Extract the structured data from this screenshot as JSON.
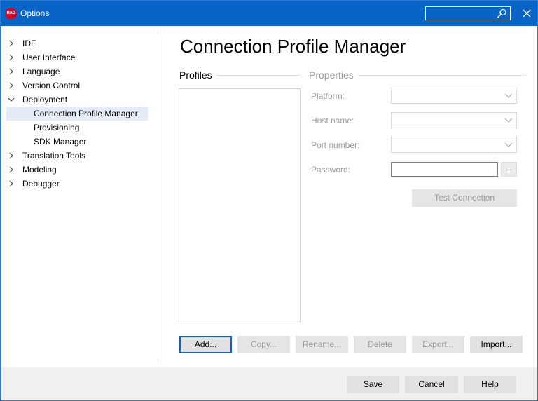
{
  "window": {
    "title": "Options",
    "app_icon_text": "RAD",
    "search_value": ""
  },
  "tree": {
    "items": [
      {
        "label": "IDE",
        "expanded": false
      },
      {
        "label": "User Interface",
        "expanded": false
      },
      {
        "label": "Language",
        "expanded": false
      },
      {
        "label": "Version Control",
        "expanded": false
      },
      {
        "label": "Deployment",
        "expanded": true
      },
      {
        "label": "Connection Profile Manager",
        "child": true,
        "selected": true
      },
      {
        "label": "Provisioning",
        "child": true
      },
      {
        "label": "SDK Manager",
        "child": true
      },
      {
        "label": "Translation Tools",
        "expanded": false
      },
      {
        "label": "Modeling",
        "expanded": false
      },
      {
        "label": "Debugger",
        "expanded": false
      }
    ]
  },
  "page": {
    "title": "Connection Profile Manager",
    "profiles_header": "Profiles",
    "properties_header": "Properties"
  },
  "properties": {
    "platform_label": "Platform:",
    "host_label": "Host name:",
    "port_label": "Port number:",
    "password_label": "Password:",
    "password_value": "",
    "browse_label": "...",
    "test_button": "Test Connection"
  },
  "profile_buttons": {
    "add": "Add...",
    "copy": "Copy...",
    "rename": "Rename...",
    "delete": "Delete",
    "export": "Export...",
    "import": "Import..."
  },
  "dialog_buttons": {
    "save": "Save",
    "cancel": "Cancel",
    "help": "Help"
  },
  "colors": {
    "titlebar": "#0a64c8",
    "app_icon": "#c8102e",
    "selection": "#e5ecf7",
    "disabled_text": "#9a9a9a"
  }
}
